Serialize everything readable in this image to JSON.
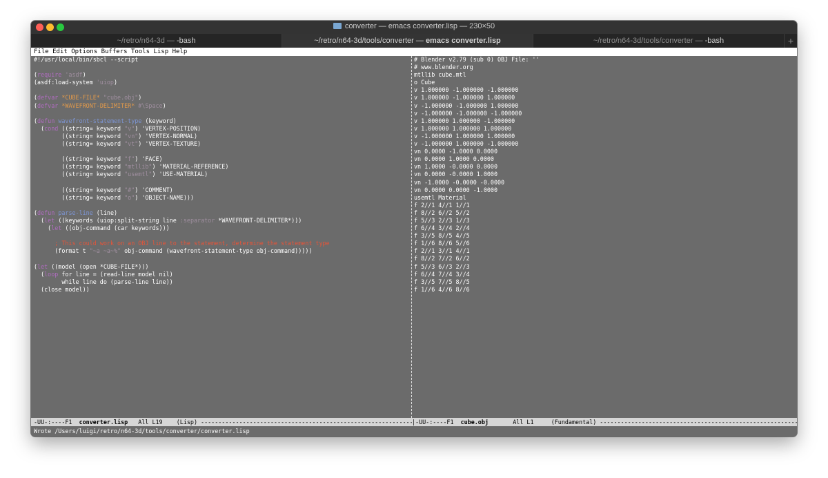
{
  "window": {
    "title": "converter — emacs converter.lisp — 230×50"
  },
  "tabs": [
    {
      "path": "~/retro/n64-3d — ",
      "cmd": "-bash",
      "active": false
    },
    {
      "path": "~/retro/n64-3d/tools/converter — ",
      "cmd": "emacs converter.lisp",
      "active": true
    },
    {
      "path": "~/retro/n64-3d/tools/converter — ",
      "cmd": "-bash",
      "active": false
    }
  ],
  "menu": [
    "File",
    "Edit",
    "Options",
    "Buffers",
    "Tools",
    "Lisp",
    "Help"
  ],
  "left_buffer": {
    "lines": [
      [
        [
          "#!/usr/local/bin/sbcl --script",
          ""
        ]
      ],
      [
        [
          "",
          ""
        ]
      ],
      [
        [
          "(",
          ""
        ],
        [
          "require",
          "kw"
        ],
        [
          " ",
          ""
        ],
        [
          "'asdf",
          "str"
        ],
        [
          ")",
          ""
        ]
      ],
      [
        [
          "(asdf:load-system ",
          ""
        ],
        [
          "'uiop",
          "str"
        ],
        [
          ")",
          ""
        ]
      ],
      [
        [
          "",
          ""
        ]
      ],
      [
        [
          "(",
          ""
        ],
        [
          "defvar",
          "kw"
        ],
        [
          " ",
          ""
        ],
        [
          "*CUBE-FILE*",
          "var"
        ],
        [
          " ",
          ""
        ],
        [
          "\"cube.obj\"",
          "str"
        ],
        [
          ")",
          ""
        ]
      ],
      [
        [
          "(",
          ""
        ],
        [
          "defvar",
          "kw"
        ],
        [
          " ",
          ""
        ],
        [
          "*WAVEFRONT-DELIMITER*",
          "var"
        ],
        [
          " ",
          ""
        ],
        [
          "#\\Space",
          "str"
        ],
        [
          ")",
          ""
        ]
      ],
      [
        [
          "",
          ""
        ]
      ],
      [
        [
          "(",
          ""
        ],
        [
          "defun",
          "kw"
        ],
        [
          " ",
          ""
        ],
        [
          "wavefront-statement-type",
          "fn"
        ],
        [
          " (keyword)",
          ""
        ]
      ],
      [
        [
          "  (",
          ""
        ],
        [
          "cond",
          "kw"
        ],
        [
          " ((string= keyword ",
          ""
        ],
        [
          "\"v\"",
          "str"
        ],
        [
          ") 'VERTEX-POSITION)",
          ""
        ]
      ],
      [
        [
          "        ((string= keyword ",
          ""
        ],
        [
          "\"vn\"",
          "str"
        ],
        [
          ") 'VERTEX-NORMAL)",
          ""
        ]
      ],
      [
        [
          "        ((string= keyword ",
          ""
        ],
        [
          "\"vt\"",
          "str"
        ],
        [
          ") 'VERTEX-TEXTURE)",
          ""
        ]
      ],
      [
        [
          "",
          ""
        ]
      ],
      [
        [
          "        ((string= keyword ",
          ""
        ],
        [
          "\"f\"",
          "str"
        ],
        [
          ") 'FACE)",
          ""
        ]
      ],
      [
        [
          "        ((string= keyword ",
          ""
        ],
        [
          "\"mtllib\"",
          "str"
        ],
        [
          ") 'MATERIAL-REFERENCE)",
          ""
        ]
      ],
      [
        [
          "        ((string= keyword ",
          ""
        ],
        [
          "\"usemtl\"",
          "str"
        ],
        [
          ") 'USE-MATERIAL)",
          ""
        ]
      ],
      [
        [
          "",
          ""
        ]
      ],
      [
        [
          "        ((string= keyword ",
          ""
        ],
        [
          "\"#\"",
          "str"
        ],
        [
          ") 'COMMENT)",
          ""
        ]
      ],
      [
        [
          "        ((string= keyword ",
          ""
        ],
        [
          "\"o\"",
          "str"
        ],
        [
          ") 'OBJECT-NAME)))",
          ""
        ]
      ],
      [
        [
          "",
          ""
        ]
      ],
      [
        [
          "(",
          ""
        ],
        [
          "defun",
          "kw"
        ],
        [
          " ",
          ""
        ],
        [
          "parse-line",
          "fn"
        ],
        [
          " (line)",
          ""
        ]
      ],
      [
        [
          "  (",
          ""
        ],
        [
          "let",
          "kw"
        ],
        [
          " ((keywords (uiop:split-string line ",
          ""
        ],
        [
          ":separator",
          "str"
        ],
        [
          " *WAVEFRONT-DELIMITER*)))",
          ""
        ]
      ],
      [
        [
          "    (",
          ""
        ],
        [
          "let",
          "kw"
        ],
        [
          " ((obj-command (car keywords)))",
          ""
        ]
      ],
      [
        [
          "",
          ""
        ]
      ],
      [
        [
          "      ",
          ""
        ],
        [
          "; This could work on an OBJ line to the statement, determine the statement type",
          "cm"
        ]
      ],
      [
        [
          "      (format t ",
          ""
        ],
        [
          "\"~a ~a~%\"",
          "str"
        ],
        [
          " obj-command (wavefront-statement-type obj-command)))))",
          ""
        ]
      ],
      [
        [
          "",
          ""
        ]
      ],
      [
        [
          "(",
          ""
        ],
        [
          "let",
          "kw"
        ],
        [
          " ((model (open *CUBE-FILE*)))",
          ""
        ]
      ],
      [
        [
          "  (",
          ""
        ],
        [
          "loop",
          "kw"
        ],
        [
          " for line = (read-line model nil)",
          ""
        ]
      ],
      [
        [
          "        while line do (parse-line line))",
          ""
        ]
      ],
      [
        [
          "  (close model))",
          ""
        ]
      ]
    ]
  },
  "right_buffer": {
    "lines": [
      "# Blender v2.79 (sub 0) OBJ File: ''",
      "# www.blender.org",
      "mtllib cube.mtl",
      "o Cube",
      "v 1.000000 -1.000000 -1.000000",
      "v 1.000000 -1.000000 1.000000",
      "v -1.000000 -1.000000 1.000000",
      "v -1.000000 -1.000000 -1.000000",
      "v 1.000000 1.000000 -1.000000",
      "v 1.000000 1.000000 1.000000",
      "v -1.000000 1.000000 1.000000",
      "v -1.000000 1.000000 -1.000000",
      "vn 0.0000 -1.0000 0.0000",
      "vn 0.0000 1.0000 0.0000",
      "vn 1.0000 -0.0000 0.0000",
      "vn 0.0000 -0.0000 1.0000",
      "vn -1.0000 -0.0000 -0.0000",
      "vn 0.0000 0.0000 -1.0000",
      "usemtl Material",
      "f 2//1 4//1 1//1",
      "f 8//2 6//2 5//2",
      "f 5//3 2//3 1//3",
      "f 6//4 3//4 2//4",
      "f 3//5 8//5 4//5",
      "f 1//6 8//6 5//6",
      "f 2//1 3//1 4//1",
      "f 8//2 7//2 6//2",
      "f 5//3 6//3 2//3",
      "f 6//4 7//4 3//4",
      "f 3//5 7//5 8//5",
      "f 1//6 4//6 8//6"
    ]
  },
  "modeline_left": {
    "prefix": "-UU-:----F1  ",
    "buffer": "converter.lisp",
    "middle": "   All L19    (Lisp) ",
    "fill": "-----------------------------------------------------------------------------------------------------------------------"
  },
  "modeline_right": {
    "prefix": "|-UU-:----F1  ",
    "buffer": "cube.obj",
    "middle": "       All L1     (Fundamental) ",
    "fill": "---------------------------------------------------------------------------------------------------------------------"
  },
  "echo_area": "Wrote /Users/luigi/retro/n64-3d/tools/converter/converter.lisp"
}
